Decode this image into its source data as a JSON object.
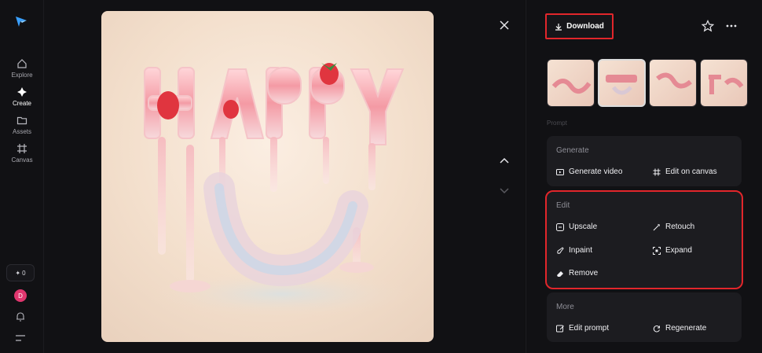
{
  "nav": {
    "items": [
      {
        "label": "Explore",
        "icon": "home-icon"
      },
      {
        "label": "Create",
        "icon": "sparkle-icon"
      },
      {
        "label": "Assets",
        "icon": "folder-icon"
      },
      {
        "label": "Canvas",
        "icon": "canvas-icon"
      }
    ],
    "credits": "0",
    "avatar_letter": "D"
  },
  "toolbar": {
    "download_label": "Download"
  },
  "panel": {
    "prompt_hint": "Prompt",
    "generate": {
      "title": "Generate",
      "actions": [
        "Generate video",
        "Edit on canvas"
      ]
    },
    "edit": {
      "title": "Edit",
      "actions": [
        "Upscale",
        "Retouch",
        "Inpaint",
        "Expand",
        "Remove"
      ]
    },
    "more": {
      "title": "More",
      "actions": [
        "Edit prompt",
        "Regenerate"
      ]
    }
  },
  "colors": {
    "accent_red": "#e2262b",
    "avatar": "#e0366e"
  }
}
